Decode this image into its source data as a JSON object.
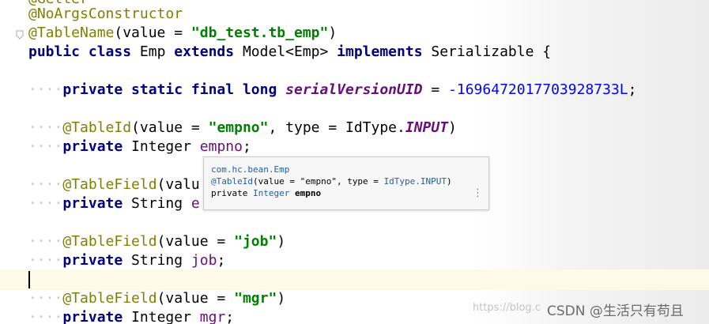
{
  "code": {
    "top_partial": "@Getter",
    "line1": "@NoArgsConstructor",
    "line2": {
      "ann": "@TableName",
      "open": "(value = ",
      "str": "\"db_test.tb_emp\"",
      "close": ")"
    },
    "line3": {
      "kw1": "public",
      "kw2": "class",
      "name": " Emp ",
      "kw3": "extends",
      "mid": " Model<Emp> ",
      "kw4": "implements",
      "end": " Serializable {"
    },
    "line4": {
      "kw": "private static final long",
      "const": "serialVersionUID",
      "eq": " = ",
      "num": "-1696472017703928733L",
      "semi": ";"
    },
    "line5": {
      "ann": "@TableId",
      "a": "(value = ",
      "str": "\"empno\"",
      "b": ", type = IdType.",
      "const": "INPUT",
      "c": ")"
    },
    "line6": {
      "kw": "private",
      "type": " Integer ",
      "field": "empno",
      "semi": ";"
    },
    "line7": {
      "ann": "@TableField",
      "a": "(valu"
    },
    "line8": {
      "kw": "private",
      "type": " String ",
      "field": "e"
    },
    "line9": {
      "ann": "@TableField",
      "a": "(value = ",
      "str": "\"job\"",
      "c": ")"
    },
    "line10": {
      "kw": "private",
      "type": " String ",
      "field": "job",
      "semi": ";"
    },
    "line11": {
      "ann": "@TableField",
      "a": "(value = ",
      "str": "\"mgr\"",
      "c": ")"
    },
    "line12": {
      "kw": "private",
      "type": " Integer ",
      "field": "mgr",
      "semi": ";"
    },
    "indent_dots": "····"
  },
  "tooltip": {
    "pkg": "com.hc.bean.Emp",
    "ann": "@TableId",
    "ann_rest": "(value = \"empno\", type = ",
    "ann_type": "IdType.INPUT",
    "ann_close": ")",
    "decl_kw": "private ",
    "decl_type": "Integer",
    "decl_field": " empno",
    "menu_icon": "⋮"
  },
  "watermark": {
    "url": "https://blog.c",
    "text": "CSDN @生活只有苟且"
  },
  "colors": {
    "annotation": "#808000",
    "keyword": "#000080",
    "string": "#008000",
    "number": "#0000ff",
    "field": "#660e7a",
    "caret_line": "#fdfbe8"
  }
}
